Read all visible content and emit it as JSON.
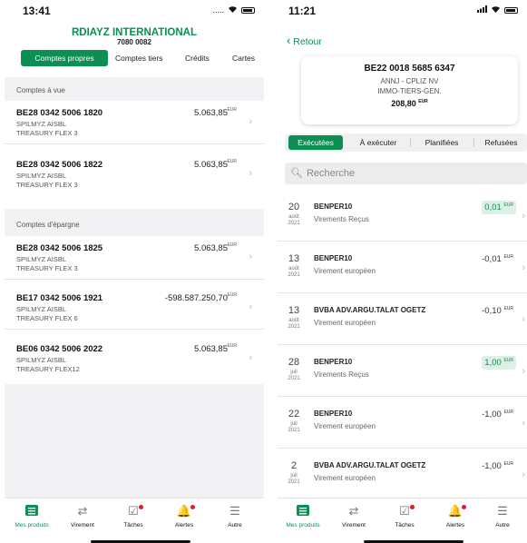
{
  "left": {
    "status": {
      "time": "13:41",
      "signal": "....."
    },
    "company": "RDIAYZ INTERNATIONAL",
    "company_no": "7080 0082",
    "tabs": [
      "Comptes propres",
      "Comptes tiers",
      "Crédits",
      "Cartes"
    ],
    "sections": [
      {
        "title": "Comptes à vue",
        "accounts": [
          {
            "iban": "BE28 0342 5006 1820",
            "holder": "SPILMYZ AISBL",
            "product": "TREASURY FLEX 3",
            "amount": "5.063,85",
            "currency": "EUR"
          },
          {
            "iban": "BE28 0342 5006 1822",
            "holder": "SPILMYZ AISBL",
            "product": "TREASURY FLEX 3",
            "amount": "5.063,85",
            "currency": "EUR"
          }
        ]
      },
      {
        "title": "Comptes d'épargne",
        "accounts": [
          {
            "iban": "BE28 0342 5006 1825",
            "holder": "SPILMYZ AISBL",
            "product": "TREASURY FLEX 3",
            "amount": "5.063,85",
            "currency": "EUR"
          },
          {
            "iban": "BE17 0342 5006 1921",
            "holder": "SPILMYZ AISBL",
            "product": "TREASURY FLEX 6",
            "amount": "-598.587.250,70",
            "currency": "EUR"
          },
          {
            "iban": "BE06 0342 5006 2022",
            "holder": "SPILMYZ AISBL",
            "product": "TREASURY FLEX12",
            "amount": "5.063,85",
            "currency": "EUR"
          }
        ]
      }
    ],
    "nav": [
      {
        "label": "Mes produits",
        "icon": "list-icon",
        "active": true
      },
      {
        "label": "Virement",
        "icon": "transfer-arrows-icon"
      },
      {
        "label": "Tâches",
        "icon": "checkbox-icon",
        "badge": true
      },
      {
        "label": "Alertes",
        "icon": "bell-icon",
        "badge": true
      },
      {
        "label": "Autre",
        "icon": "hamburger-menu-icon"
      }
    ]
  },
  "right": {
    "status": {
      "time": "11:21"
    },
    "back_label": "Retour",
    "account": {
      "iban": "BE22 0018 5685 6347",
      "name1": "ANNJ - CPLIZ NV",
      "name2": "IMMO-TIERS-GEN.",
      "balance": "208,80",
      "currency": "EUR"
    },
    "segments": [
      "Exécutées",
      "À exécuter",
      "Planifiées",
      "Refusées"
    ],
    "search_placeholder": "Recherche",
    "transactions": [
      {
        "day": "20",
        "month": "août",
        "year": "2021",
        "name": "BENPER10",
        "desc": "Virements Reçus",
        "amount": "0,01",
        "currency": "EUR",
        "positive": true
      },
      {
        "day": "13",
        "month": "août",
        "year": "2021",
        "name": "BENPER10",
        "desc": "Virement européen",
        "amount": "-0,01",
        "currency": "EUR",
        "positive": false
      },
      {
        "day": "13",
        "month": "août",
        "year": "2021",
        "name": "BVBA ADV.ARGU.TALAT OGETZ",
        "desc": "Virement européen",
        "amount": "-0,10",
        "currency": "EUR",
        "positive": false
      },
      {
        "day": "28",
        "month": "juil",
        "year": "2021",
        "name": "BENPER10",
        "desc": "Virements Reçus",
        "amount": "1,00",
        "currency": "EUR",
        "positive": true
      },
      {
        "day": "22",
        "month": "juil",
        "year": "2021",
        "name": "BENPER10",
        "desc": "Virement européen",
        "amount": "-1,00",
        "currency": "EUR",
        "positive": false
      },
      {
        "day": "2",
        "month": "juil",
        "year": "2021",
        "name": "BVBA ADV.ARGU.TALAT OGETZ",
        "desc": "Virement européen",
        "amount": "-1,00",
        "currency": "EUR",
        "positive": false
      }
    ],
    "nav": [
      {
        "label": "Mes produits",
        "icon": "list-icon",
        "active": true
      },
      {
        "label": "Virement",
        "icon": "transfer-arrows-icon"
      },
      {
        "label": "Tâches",
        "icon": "checkbox-icon",
        "badge": true
      },
      {
        "label": "Alertes",
        "icon": "bell-icon",
        "badge": true
      },
      {
        "label": "Autre",
        "icon": "hamburger-menu-icon"
      }
    ]
  },
  "colors": {
    "brand": "#0b8f53",
    "badge": "#e01b2d"
  }
}
